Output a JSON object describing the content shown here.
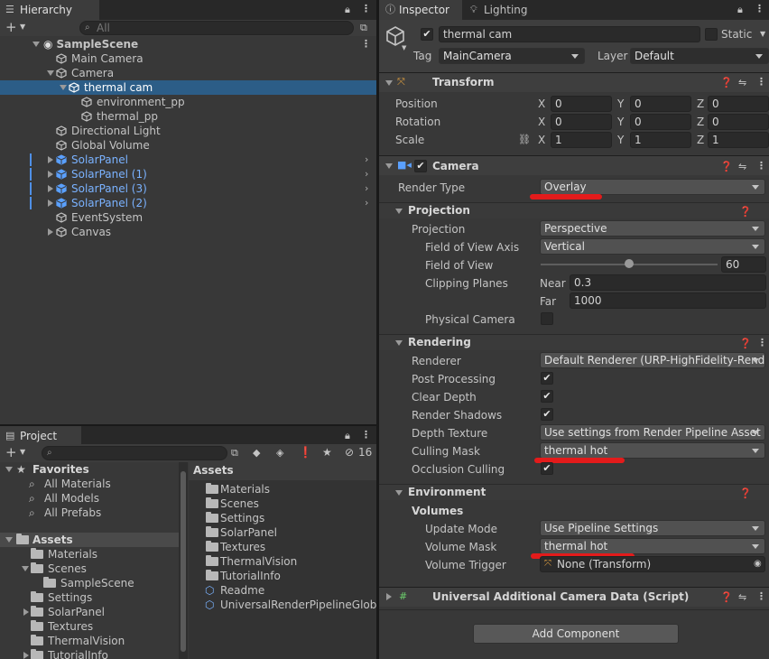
{
  "hierarchy": {
    "tab_label": "Hierarchy",
    "search_placeholder": "All",
    "items": [
      {
        "label": "SampleScene",
        "indent": 0,
        "expanded": true,
        "scene": true
      },
      {
        "label": "Main Camera",
        "indent": 1
      },
      {
        "label": "Camera",
        "indent": 1,
        "expanded": true
      },
      {
        "label": "thermal cam",
        "indent": 2,
        "expanded": true,
        "selected": true
      },
      {
        "label": "environment_pp",
        "indent": 3
      },
      {
        "label": "thermal_pp",
        "indent": 3
      },
      {
        "label": "Directional Light",
        "indent": 1
      },
      {
        "label": "Global Volume",
        "indent": 1
      },
      {
        "label": "SolarPanel",
        "indent": 1,
        "prefab": true
      },
      {
        "label": "SolarPanel (1)",
        "indent": 1,
        "prefab": true
      },
      {
        "label": "SolarPanel (3)",
        "indent": 1,
        "prefab": true
      },
      {
        "label": "SolarPanel (2)",
        "indent": 1,
        "prefab": true
      },
      {
        "label": "EventSystem",
        "indent": 1
      },
      {
        "label": "Canvas",
        "indent": 1,
        "collapsed": true
      }
    ]
  },
  "project": {
    "tab_label": "Project",
    "hidden_count": "16",
    "favorites_label": "Favorites",
    "favorites": [
      "All Materials",
      "All Models",
      "All Prefabs"
    ],
    "assets_label": "Assets",
    "tree": [
      {
        "label": "Materials",
        "indent": 1
      },
      {
        "label": "Scenes",
        "indent": 1,
        "expanded": true
      },
      {
        "label": "SampleScene",
        "indent": 2
      },
      {
        "label": "Settings",
        "indent": 1
      },
      {
        "label": "SolarPanel",
        "indent": 1,
        "collapsed": true
      },
      {
        "label": "Textures",
        "indent": 1
      },
      {
        "label": "ThermalVision",
        "indent": 1
      },
      {
        "label": "TutorialInfo",
        "indent": 1,
        "collapsed": true
      }
    ],
    "breadcrumb": "Assets",
    "contents": [
      {
        "label": "Materials",
        "kind": "folder"
      },
      {
        "label": "Scenes",
        "kind": "folder"
      },
      {
        "label": "Settings",
        "kind": "folder"
      },
      {
        "label": "SolarPanel",
        "kind": "folder"
      },
      {
        "label": "Textures",
        "kind": "folder"
      },
      {
        "label": "ThermalVision",
        "kind": "folder"
      },
      {
        "label": "TutorialInfo",
        "kind": "folder"
      },
      {
        "label": "Readme",
        "kind": "asset"
      },
      {
        "label": "UniversalRenderPipelineGlobal",
        "kind": "asset"
      }
    ]
  },
  "inspector": {
    "tab_label": "Inspector",
    "lighting_tab_label": "Lighting",
    "object_name": "thermal cam",
    "static_label": "Static",
    "tag_label": "Tag",
    "tag_value": "MainCamera",
    "layer_label": "Layer",
    "layer_value": "Default",
    "transform": {
      "title": "Transform",
      "position_label": "Position",
      "rotation_label": "Rotation",
      "scale_label": "Scale",
      "position": [
        "0",
        "0",
        "0"
      ],
      "rotation": [
        "0",
        "0",
        "0"
      ],
      "scale": [
        "1",
        "1",
        "1"
      ],
      "axis_x": "X",
      "axis_y": "Y",
      "axis_z": "Z"
    },
    "camera": {
      "title": "Camera",
      "render_type_label": "Render Type",
      "render_type": "Overlay",
      "projection_section": "Projection",
      "projection_label": "Projection",
      "projection": "Perspective",
      "fov_axis_label": "Field of View Axis",
      "fov_axis": "Vertical",
      "fov_label": "Field of View",
      "fov": "60",
      "fov_slider_fraction": 0.5,
      "clipping_label": "Clipping Planes",
      "near_label": "Near",
      "near": "0.3",
      "far_label": "Far",
      "far": "1000",
      "physical_label": "Physical Camera",
      "rendering_section": "Rendering",
      "renderer_label": "Renderer",
      "renderer": "Default Renderer (URP-HighFidelity-Renderer)",
      "post_processing_label": "Post Processing",
      "clear_depth_label": "Clear Depth",
      "render_shadows_label": "Render Shadows",
      "depth_texture_label": "Depth Texture",
      "depth_texture": "Use settings from Render Pipeline Asset",
      "culling_mask_label": "Culling Mask",
      "culling_mask": "thermal hot",
      "occlusion_label": "Occlusion Culling",
      "environment_section": "Environment",
      "volumes_label": "Volumes",
      "update_mode_label": "Update Mode",
      "update_mode": "Use Pipeline Settings",
      "volume_mask_label": "Volume Mask",
      "volume_mask": "thermal hot",
      "volume_trigger_label": "Volume Trigger",
      "volume_trigger": "None (Transform)"
    },
    "additional_data_title": "Universal Additional Camera Data (Script)",
    "add_component_label": "Add Component"
  },
  "colors": {
    "highlight": "#e31b1b",
    "selection": "#2c5d87",
    "prefab_text": "#7ab2ff"
  }
}
